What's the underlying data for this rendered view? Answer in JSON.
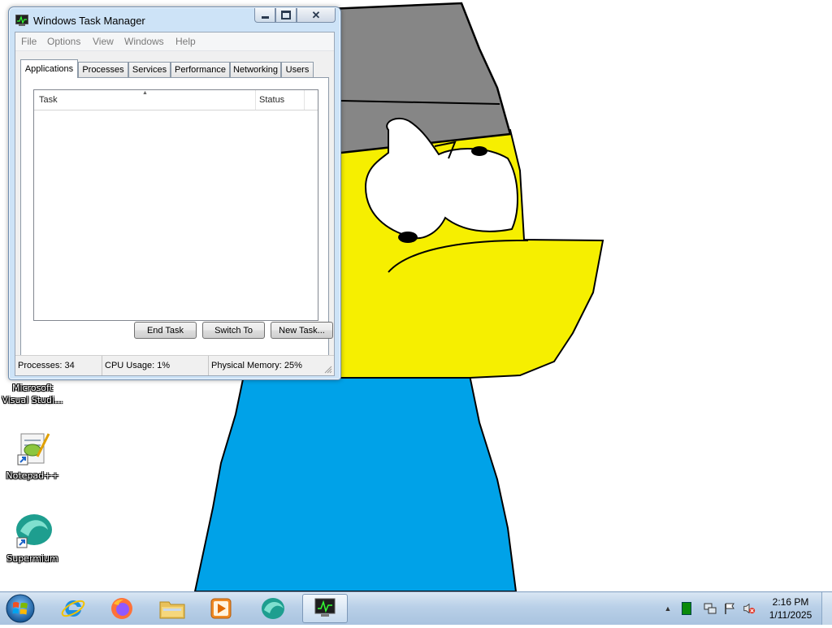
{
  "window": {
    "title": "Windows Task Manager",
    "menu": [
      "File",
      "Options",
      "View",
      "Windows",
      "Help"
    ],
    "tabs": [
      "Applications",
      "Processes",
      "Services",
      "Performance",
      "Networking",
      "Users"
    ],
    "active_tab": "Applications",
    "list": {
      "columns": [
        "Task",
        "Status"
      ],
      "rows": []
    },
    "buttons": {
      "end_task": "End Task",
      "switch_to": "Switch To",
      "new_task": "New Task..."
    },
    "status": {
      "processes": "Processes: 34",
      "cpu": "CPU Usage: 1%",
      "memory": "Physical Memory: 25%"
    }
  },
  "desktop_icons": [
    {
      "label": "Microsoft Visual Studi...",
      "icon": "visual-studio-icon"
    },
    {
      "label": "Notepad++",
      "icon": "notepad-plus-plus-icon"
    },
    {
      "label": "Supermium",
      "icon": "supermium-icon"
    }
  ],
  "taskbar": {
    "pinned": [
      "start-orb",
      "internet-explorer-icon",
      "firefox-icon",
      "file-explorer-icon",
      "media-player-icon",
      "supermium-icon",
      "task-manager-icon"
    ],
    "clock": {
      "time": "2:16 PM",
      "date": "1/11/2025"
    },
    "tray": [
      "show-hidden-icons",
      "green-status-icon",
      "network-icon",
      "action-center-flag-icon",
      "volume-muted-icon"
    ]
  },
  "colors": {
    "face_yellow": "#f5ee00",
    "hat_gray": "#858585",
    "shirt_blue": "#00a2e8",
    "window_frame": "#cde3f7",
    "taskbar": "#b9d0e8"
  }
}
